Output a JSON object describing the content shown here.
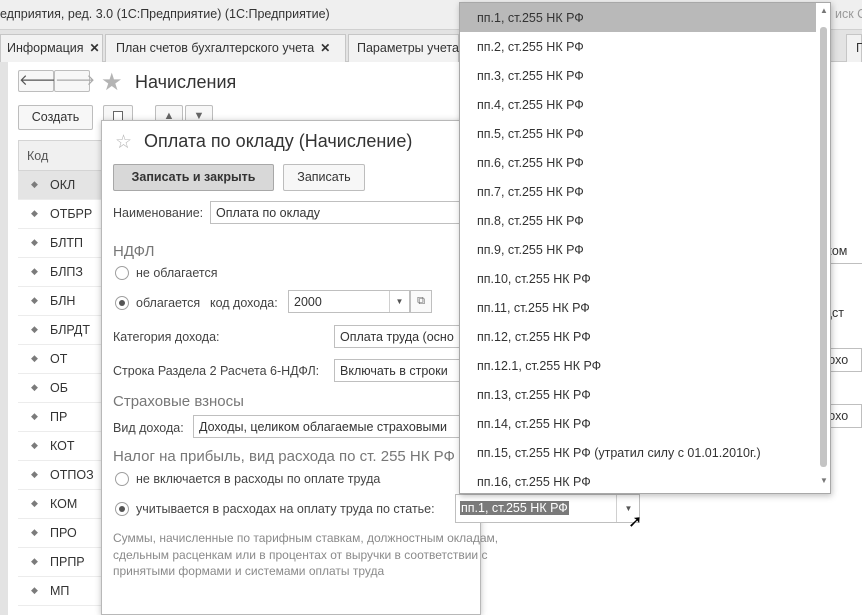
{
  "window": {
    "title": "едприятия, ред. 3.0 (1С:Предприятие)  (1С:Предприятие)",
    "search_placeholder": "иск С"
  },
  "tabs": [
    {
      "label": "Информация"
    },
    {
      "label": "План счетов бухгалтерского учета"
    },
    {
      "label": "Параметры учета"
    },
    {
      "label": "П"
    }
  ],
  "list": {
    "title": "Начисления",
    "create_label": "Создать",
    "code_header": "Код",
    "codes": [
      "ОКЛ",
      "ОТБРР",
      "БЛТП",
      "БЛПЗ",
      "БЛН",
      "БЛРДТ",
      "ОТ",
      "ОБ",
      "ПР",
      "КОТ",
      "ОТПОЗ",
      "КОМ",
      "ПРО",
      "ПРПР",
      "МП"
    ]
  },
  "dialog": {
    "title": "Оплата по окладу (Начисление)",
    "save_close_label": "Записать и закрыть",
    "save_label": "Записать",
    "name_label": "Наименование:",
    "name_value": "Оплата по окладу",
    "ndfl_section": "НДФЛ",
    "ndfl_not_taxed": "не облагается",
    "ndfl_taxed": "облагается",
    "income_code_label": "код дохода:",
    "income_code_value": "2000",
    "income_category_label": "Категория дохода:",
    "income_category_value": "Оплата труда (осно",
    "line_6ndfl_label": "Строка Раздела 2 Расчета 6-НДФЛ:",
    "line_6ndfl_value": "Включать в строки",
    "insurance_section": "Страховые взносы",
    "income_type_label": "Вид дохода:",
    "income_type_value": "Доходы, целиком облагаемые страховыми",
    "profit_tax_section": "Налог на прибыль, вид расхода по ст. 255 НК РФ",
    "not_included_label": "не включается в расходы по оплате труда",
    "included_label": "учитывается в расходах на оплату труда по статье:",
    "included_value": "пп.1, ст.255 НК РФ",
    "note": "Суммы, начисленные по тарифным ставкам, должностным окладам, сдельным расценкам или в процентах от выручки в соответствии с принятыми формами и системами оплаты труда"
  },
  "dropdown": {
    "items": [
      "пп.1, ст.255 НК РФ",
      "пп.2, ст.255 НК РФ",
      "пп.3, ст.255 НК РФ",
      "пп.4, ст.255 НК РФ",
      "пп.5, ст.255 НК РФ",
      "пп.6, ст.255 НК РФ",
      "пп.7, ст.255 НК РФ",
      "пп.8, ст.255 НК РФ",
      "пп.9, ст.255 НК РФ",
      "пп.10, ст.255 НК РФ",
      "пп.11, ст.255 НК РФ",
      "пп.12, ст.255 НК РФ",
      "пп.12.1, ст.255 НК РФ",
      "пп.13, ст.255 НК РФ",
      "пп.14, ст.255 НК РФ",
      "пп.15, ст.255 НК РФ (утратил силу с 01.01.2010г.)",
      "пп.16, ст.255 НК РФ"
    ]
  },
  "background_fields": [
    "ском",
    "одст",
    "дохо",
    "дохо"
  ],
  "colors": {
    "highlight": "#b9b9b9",
    "primary_button": "#d8d8d8",
    "selection_text_bg": "#7a7a7a"
  }
}
